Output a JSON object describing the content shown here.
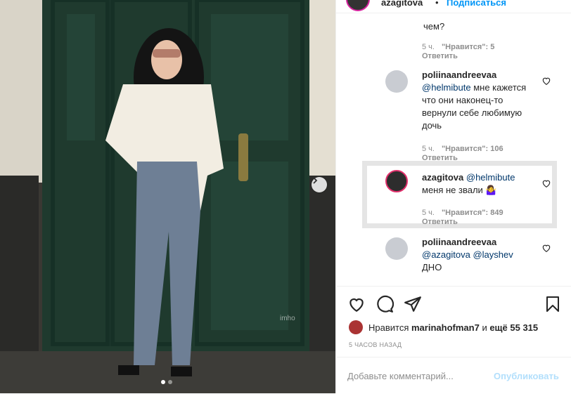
{
  "header": {
    "username": "azagitova",
    "separator": "•",
    "follow_label": "Подписаться"
  },
  "comments": {
    "partial_text": "чем?",
    "first_meta": {
      "time": "5 ч.",
      "likes": "\"Нравится\": 5",
      "reply": "Ответить"
    },
    "items": [
      {
        "username": "poliinaandreevaa",
        "mention": "@helmibute",
        "text": "мне кажется что они наконец-то вернули себе любимую дочь",
        "time": "5 ч.",
        "likes": "\"Нравится\": 106",
        "reply": "Ответить"
      },
      {
        "username": "azagitova",
        "mention": "@helmibute",
        "text": "меня не звали 🤷‍♀️",
        "time": "5 ч.",
        "likes": "\"Нравится\": 849",
        "reply": "Ответить"
      },
      {
        "username": "poliinaandreevaa",
        "mention": "@azagitova @layshev",
        "text": "ДНО"
      }
    ]
  },
  "actions": {
    "icons": [
      "heart-icon",
      "comment-icon",
      "share-icon",
      "bookmark-icon"
    ]
  },
  "likes": {
    "prefix": "Нравится",
    "user": "marinahofman7",
    "connector": "и",
    "others": "ещё 55 315"
  },
  "timestamp": "5 ЧАСОВ НАЗАД",
  "add_comment": {
    "placeholder": "Добавьте комментарий...",
    "publish_label": "Опубликовать"
  },
  "photo": {
    "watermark": "imho",
    "carousel": {
      "count": 2,
      "active": 1
    }
  },
  "colors": {
    "link": "#0095f6",
    "mention": "#00376b",
    "muted": "#8e8e8e",
    "door": "#1f3a2e"
  }
}
